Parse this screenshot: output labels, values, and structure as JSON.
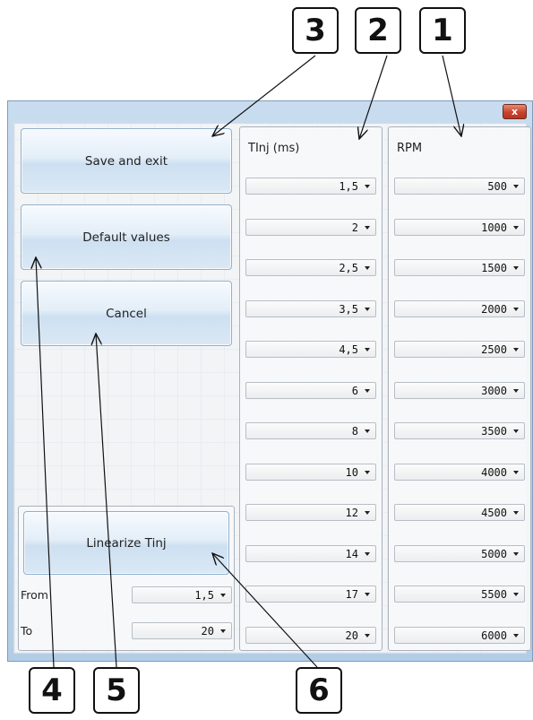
{
  "callouts": [
    "3",
    "2",
    "1",
    "4",
    "5",
    "6"
  ],
  "window": {
    "close_label": "x"
  },
  "actions": {
    "save_exit": "Save and exit",
    "defaults": "Default values",
    "cancel": "Cancel",
    "linearize": "Linearize Tinj"
  },
  "tinj": {
    "header": "TInj (ms)",
    "values": [
      "1,5",
      "2",
      "2,5",
      "3,5",
      "4,5",
      "6",
      "8",
      "10",
      "12",
      "14",
      "17",
      "20"
    ]
  },
  "rpm": {
    "header": "RPM",
    "values": [
      "500",
      "1000",
      "1500",
      "2000",
      "2500",
      "3000",
      "3500",
      "4000",
      "4500",
      "5000",
      "5500",
      "6000"
    ]
  },
  "linearize": {
    "from_label": "From",
    "from_value": "1,5",
    "to_label": "To",
    "to_value": "20"
  }
}
